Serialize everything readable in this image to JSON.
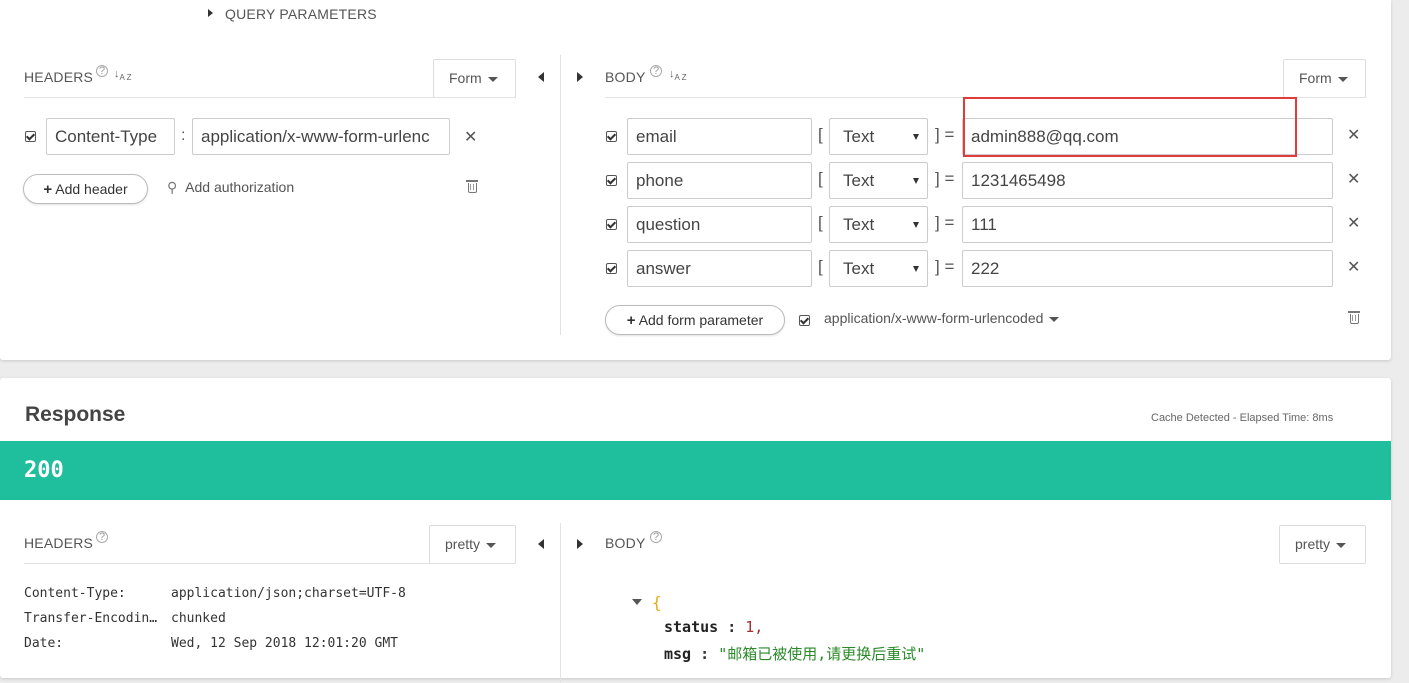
{
  "request": {
    "query_params_label": "QUERY PARAMETERS",
    "headers": {
      "label": "HEADERS",
      "mode": "Form",
      "items": [
        {
          "name": "Content-Type",
          "value": "application/x-www-form-urlenc"
        }
      ],
      "add_header": "Add header",
      "add_authorization": "Add authorization"
    },
    "body": {
      "label": "BODY",
      "mode": "Form",
      "params": [
        {
          "name": "email",
          "type": "Text",
          "value": "admin888@qq.com"
        },
        {
          "name": "phone",
          "type": "Text",
          "value": "1231465498"
        },
        {
          "name": "question",
          "type": "Text",
          "value": "111"
        },
        {
          "name": "answer",
          "type": "Text",
          "value": "222"
        }
      ],
      "add_param": "Add form parameter",
      "encoding": "application/x-www-form-urlencoded"
    }
  },
  "response": {
    "title": "Response",
    "meta": "Cache Detected - Elapsed Time: 8ms",
    "status_code": "200",
    "status_color": "#1fbe9c",
    "highlight_color": "#e03c3c",
    "headers": {
      "label": "HEADERS",
      "mode": "pretty",
      "rows": [
        {
          "k": "Content-Type:",
          "v": "application/json;charset=UTF-8"
        },
        {
          "k": "Transfer-Encodin…",
          "v": "chunked"
        },
        {
          "k": "Date:",
          "v": "Wed, 12 Sep 2018 12:01:20 GMT"
        }
      ]
    },
    "body": {
      "label": "BODY",
      "mode": "pretty",
      "open_brace": "{",
      "fields": [
        {
          "key": "status",
          "value": "1,"
        },
        {
          "key": "msg",
          "value": "\"邮箱已被使用,请更换后重试\""
        }
      ]
    }
  }
}
